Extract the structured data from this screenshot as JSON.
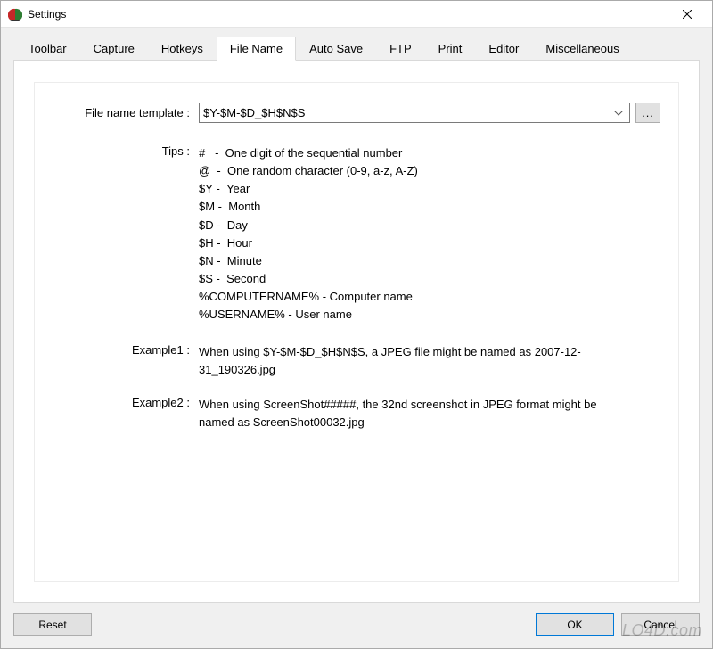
{
  "window": {
    "title": "Settings"
  },
  "tabs": [
    {
      "label": "Toolbar"
    },
    {
      "label": "Capture"
    },
    {
      "label": "Hotkeys"
    },
    {
      "label": "File Name"
    },
    {
      "label": "Auto Save"
    },
    {
      "label": "FTP"
    },
    {
      "label": "Print"
    },
    {
      "label": "Editor"
    },
    {
      "label": "Miscellaneous"
    }
  ],
  "activeTabIndex": 3,
  "fileNameTab": {
    "templateLabel": "File name template :",
    "templateValue": "$Y-$M-$D_$H$N$S",
    "browseLabel": "...",
    "tipsLabel": "Tips :",
    "tips": [
      {
        "sym": "#",
        "sep": "   -  ",
        "desc": "One digit of the sequential number"
      },
      {
        "sym": "@",
        "sep": "  -  ",
        "desc": "One random character (0-9, a-z, A-Z)"
      },
      {
        "sym": "$Y",
        "sep": " -  ",
        "desc": "Year"
      },
      {
        "sym": "$M",
        "sep": " -  ",
        "desc": "Month"
      },
      {
        "sym": "$D",
        "sep": " -  ",
        "desc": "Day"
      },
      {
        "sym": "$H",
        "sep": " -  ",
        "desc": "Hour"
      },
      {
        "sym": "$N",
        "sep": " -  ",
        "desc": "Minute"
      },
      {
        "sym": "$S",
        "sep": " -  ",
        "desc": "Second"
      },
      {
        "sym": "%COMPUTERNAME%",
        "sep": " - ",
        "desc": "Computer name"
      },
      {
        "sym": "%USERNAME%",
        "sep": " - ",
        "desc": "User name"
      }
    ],
    "example1Label": "Example1 :",
    "example1Text": "When using $Y-$M-$D_$H$N$S, a JPEG file might be named as 2007-12-31_190326.jpg",
    "example2Label": "Example2 :",
    "example2Text": "When using ScreenShot#####, the 32nd screenshot in JPEG format might be named as ScreenShot00032.jpg"
  },
  "buttons": {
    "reset": "Reset",
    "ok": "OK",
    "cancel": "Cancel"
  },
  "watermark": "LO4D.com"
}
